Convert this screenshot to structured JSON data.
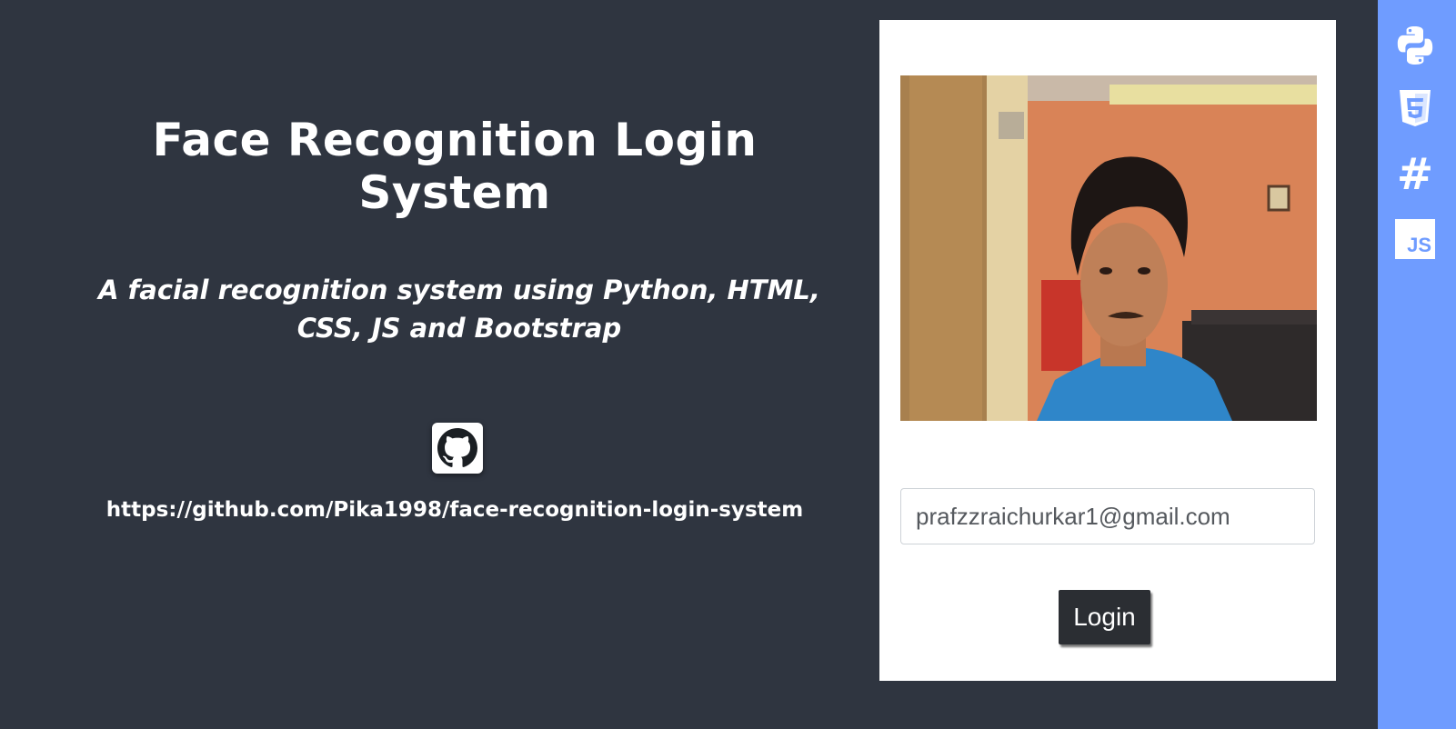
{
  "header": {
    "title": "Face Recognition Login System",
    "subtitle": "A facial recognition system using Python, HTML, CSS, JS and Bootstrap"
  },
  "repo": {
    "icon": "github-icon",
    "url": "https://github.com/Pika1998/face-recognition-login-system"
  },
  "login_card": {
    "webcam_feed": "webcam-image",
    "email_value": "prafzzraichurkar1@gmail.com",
    "login_label": "Login"
  },
  "sidebar": {
    "icons": [
      "python-icon",
      "html5-icon",
      "css-icon",
      "javascript-icon"
    ],
    "js_text": "JS",
    "css_text": "#"
  },
  "colors": {
    "background": "#2f3540",
    "sidebar": "#6f9cff",
    "card": "#ffffff",
    "button": "#2b2e33"
  }
}
